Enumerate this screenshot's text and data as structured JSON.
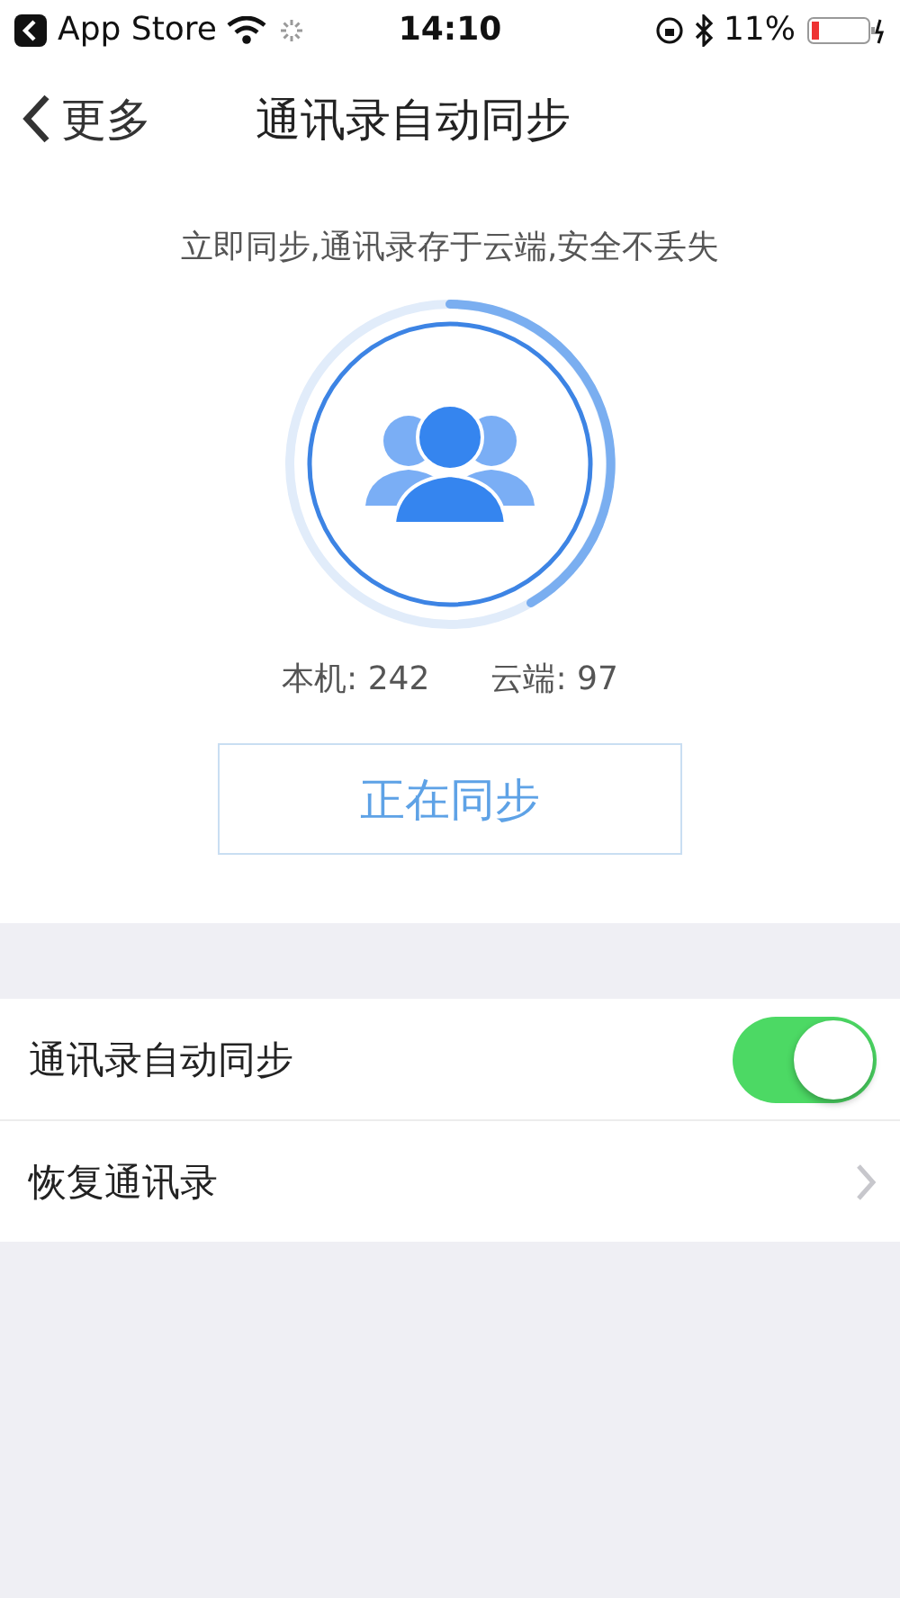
{
  "status_bar": {
    "back_app": "App Store",
    "time": "14:10",
    "battery": "11%"
  },
  "nav": {
    "back": "更多",
    "title": "通讯录自动同步"
  },
  "sync": {
    "tagline": "立即同步,通讯录存于云端,安全不丢失",
    "local_label": "本机:",
    "local_count": "242",
    "cloud_label": "云端:",
    "cloud_count": "97",
    "button": "正在同步"
  },
  "settings": [
    {
      "kind": "toggle",
      "label": "通讯录自动同步",
      "on": true
    },
    {
      "kind": "link",
      "label": "恢复通讯录"
    }
  ]
}
